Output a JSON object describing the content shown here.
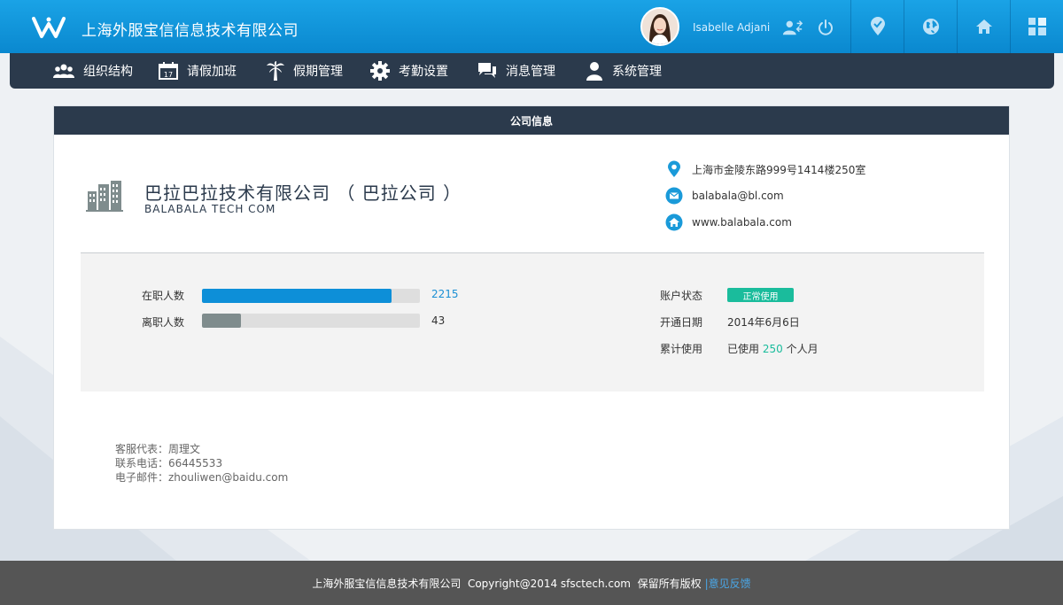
{
  "header": {
    "company_title": "上海外服宝信信息技术有限公司",
    "user_name": "Isabelle Adjani"
  },
  "nav": {
    "items": [
      {
        "label": "组织结构",
        "icon": "org-structure-icon"
      },
      {
        "label": "请假加班",
        "icon": "calendar-icon"
      },
      {
        "label": "假期管理",
        "icon": "palm-tree-icon"
      },
      {
        "label": "考勤设置",
        "icon": "gear-icon"
      },
      {
        "label": "消息管理",
        "icon": "chat-icon"
      },
      {
        "label": "系统管理",
        "icon": "user-icon"
      }
    ]
  },
  "card": {
    "title": "公司信息",
    "company_name": "巴拉巴拉技术有限公司 （ 巴拉公司 ）",
    "company_en": "BALABALA TECH COM",
    "address": "上海市金陵东路999号1414楼250室",
    "email": "balabala@bl.com",
    "website": "www.balabala.com"
  },
  "stats": {
    "active_label": "在职人数",
    "active_value": "2215",
    "active_fraction": 0.87,
    "left_label": "离职人数",
    "left_value": "43",
    "left_fraction": 0.18,
    "account_status_label": "账户状态",
    "account_status": "正常使用",
    "open_date_label": "开通日期",
    "open_date": "2014年6月6日",
    "usage_label": "累计使用",
    "usage_prefix": "已使用",
    "usage_value": "250",
    "usage_suffix": "个人月"
  },
  "service": {
    "rep": "客服代表：周理文",
    "phone": "联系电话：66445533",
    "email": "电子邮件：zhouliwen@baidu.com"
  },
  "footer": {
    "text": "上海外服宝信信息技术有限公司  Copyright@2014 sfsctech.com  保留所有版权",
    "link": "|意见反馈"
  },
  "colors": {
    "header_blue": "#0a88cf",
    "nav_dark": "#2b3a4c",
    "bar_blue": "#0d8fd8",
    "bar_gray": "#7f8c8d",
    "status_green": "#1abc9c"
  }
}
